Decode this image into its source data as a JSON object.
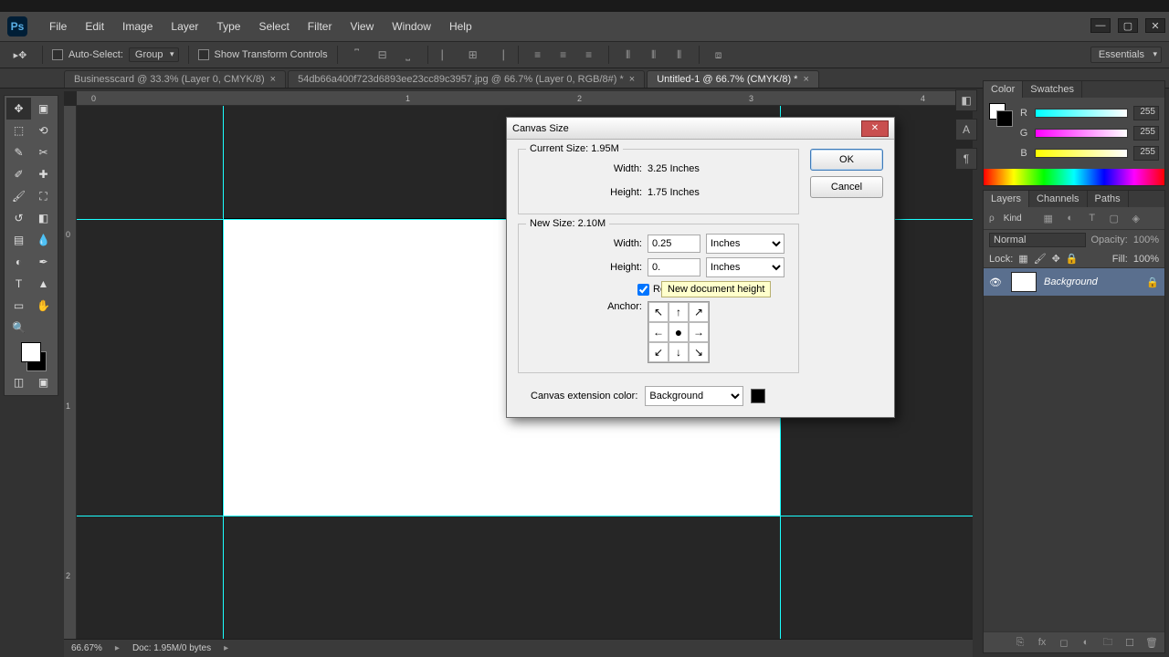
{
  "menu": {
    "items": [
      "File",
      "Edit",
      "Image",
      "Layer",
      "Type",
      "Select",
      "Filter",
      "View",
      "Window",
      "Help"
    ]
  },
  "optbar": {
    "autoSelectLabel": "Auto-Select:",
    "autoSelectValue": "Group",
    "showTransformLabel": "Show Transform Controls"
  },
  "workspace": "Essentials",
  "tabs": [
    {
      "label": "Businesscard @ 33.3% (Layer 0, CMYK/8)",
      "active": false
    },
    {
      "label": "54db66a400f723d6893ee23cc89c3957.jpg @ 66.7% (Layer 0, RGB/8#) *",
      "active": false
    },
    {
      "label": "Untitled-1 @ 66.7% (CMYK/8) *",
      "active": true
    }
  ],
  "rulerH": {
    "m0": "0",
    "m1": "1",
    "m2": "2",
    "m3": "3",
    "m4": "4"
  },
  "rulerV": {
    "m0": "0",
    "m1": "1",
    "m2": "2"
  },
  "status": {
    "zoom": "66.67%",
    "doc": "Doc: 1.95M/0 bytes"
  },
  "dialog": {
    "title": "Canvas Size",
    "ok": "OK",
    "cancel": "Cancel",
    "currentLegend": "Current Size: 1.95M",
    "widthLabel": "Width:",
    "curWidth": "3.25 Inches",
    "heightLabel": "Height:",
    "curHeight": "1.75 Inches",
    "newLegend": "New Size: 2.10M",
    "newWidth": "0.25",
    "newHeight": "0.",
    "unit": "Inches",
    "relativeLabel": "Relative",
    "anchorLabel": "Anchor:",
    "tooltip": "New document height",
    "extLabel": "Canvas extension color:",
    "extValue": "Background"
  },
  "colorPanel": {
    "tab1": "Color",
    "tab2": "Swatches",
    "r": "R",
    "g": "G",
    "b": "B",
    "rv": "255",
    "gv": "255",
    "bv": "255"
  },
  "layersPanel": {
    "tab1": "Layers",
    "tab2": "Channels",
    "tab3": "Paths",
    "kind": "Kind",
    "blend": "Normal",
    "opacityLabel": "Opacity:",
    "opacity": "100%",
    "lockLabel": "Lock:",
    "fillLabel": "Fill:",
    "fill": "100%",
    "layerName": "Background"
  }
}
